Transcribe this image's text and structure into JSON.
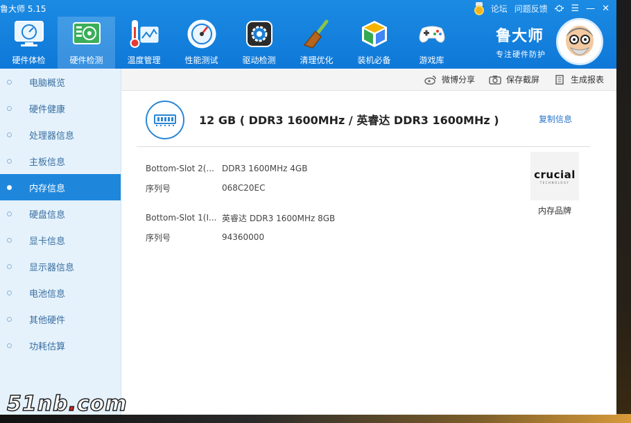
{
  "app": {
    "title": "鲁大师 5.15"
  },
  "top_links": {
    "forum": "论坛",
    "feedback": "问题反馈"
  },
  "toolbar": [
    {
      "label": "硬件体检",
      "icon": "monitor-gauge-icon"
    },
    {
      "label": "硬件检测",
      "icon": "circuit-board-icon"
    },
    {
      "label": "温度管理",
      "icon": "thermometer-icon"
    },
    {
      "label": "性能测试",
      "icon": "speedometer-icon"
    },
    {
      "label": "驱动检测",
      "icon": "gear-chip-icon"
    },
    {
      "label": "清理优化",
      "icon": "broom-icon"
    },
    {
      "label": "装机必备",
      "icon": "cube-icon"
    },
    {
      "label": "游戏库",
      "icon": "gamepad-icon"
    }
  ],
  "brand": {
    "name": "鲁大师",
    "slogan": "专注硬件防护"
  },
  "sidebar": {
    "items": [
      {
        "label": "电脑概览"
      },
      {
        "label": "硬件健康"
      },
      {
        "label": "处理器信息"
      },
      {
        "label": "主板信息"
      },
      {
        "label": "内存信息"
      },
      {
        "label": "硬盘信息"
      },
      {
        "label": "显卡信息"
      },
      {
        "label": "显示器信息"
      },
      {
        "label": "电池信息"
      },
      {
        "label": "其他硬件"
      },
      {
        "label": "功耗估算"
      }
    ],
    "active": "内存信息"
  },
  "actions": {
    "share": "微博分享",
    "screenshot": "保存截屏",
    "report": "生成报表"
  },
  "memory": {
    "summary": "12 GB ( DDR3 1600MHz / 英睿达 DDR3 1600MHz )",
    "copy_label": "复制信息",
    "slots": [
      {
        "slot": "Bottom-Slot 2(...",
        "spec": "DDR3 1600MHz 4GB",
        "serial_label": "序列号",
        "serial": "068C20EC"
      },
      {
        "slot": "Bottom-Slot 1(I...",
        "spec": "英睿达 DDR3 1600MHz 8GB",
        "serial_label": "序列号",
        "serial": "94360000"
      }
    ],
    "brand_logo_text": "crucial",
    "brand_logo_sub": "TECHNOLOGY",
    "brand_label": "内存品牌"
  },
  "watermark": {
    "left": "51nb",
    "dot": ".",
    "right": "com"
  }
}
